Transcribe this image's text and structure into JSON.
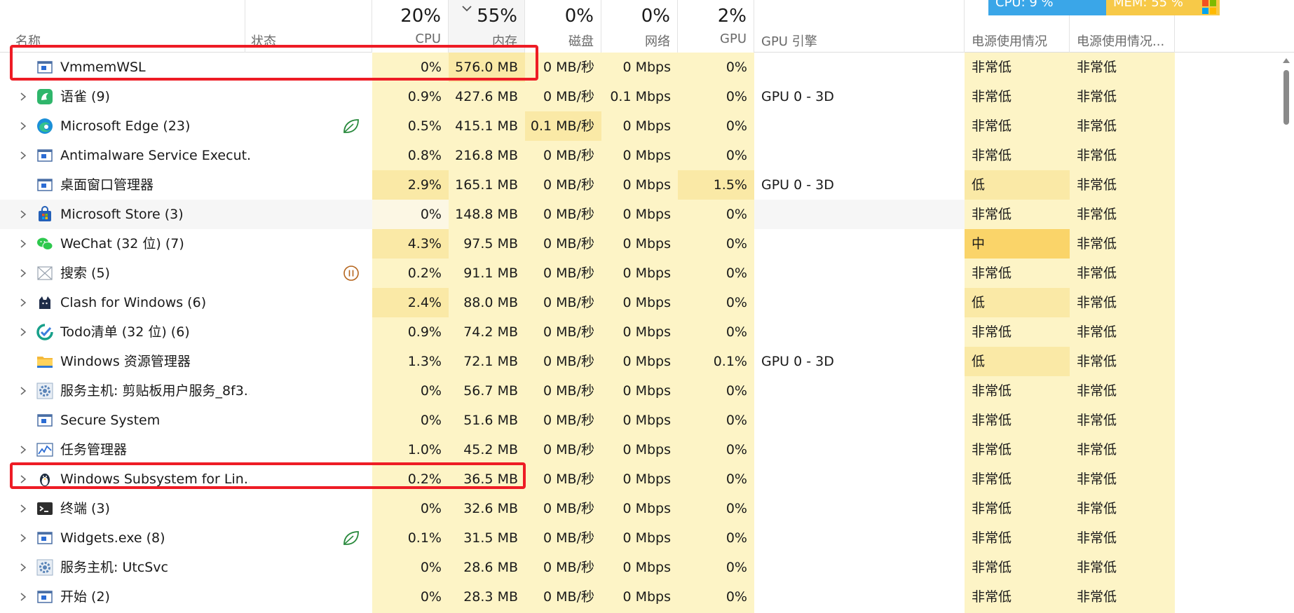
{
  "header": {
    "name_label": "名称",
    "status_label": "状态",
    "cpu_pct": "20%",
    "cpu_label": "CPU",
    "mem_pct": "55%",
    "mem_label": "内存",
    "disk_pct": "0%",
    "disk_label": "磁盘",
    "net_pct": "0%",
    "net_label": "网络",
    "gpu_pct": "2%",
    "gpu_label": "GPU",
    "gpu_engine_label": "GPU 引擎",
    "power_label": "电源使用情况",
    "power_trend_label": "电源使用情况..."
  },
  "overlay": {
    "cpu_text": "CPU: 9 %",
    "mem_text": "MEM: 55 %"
  },
  "colors": {
    "heat_low": "#fdf4c6",
    "heat_mid": "#fae9a6",
    "heat_high": "#fad469",
    "highlight_box": "#ee1c25",
    "cpu_overlay": "#3aa6e8",
    "mem_overlay": "#f7c948"
  },
  "rows": [
    {
      "name": "VmmemWSL",
      "icon": "app-window-icon",
      "expand": false,
      "status": "",
      "cpu": "0%",
      "mem": "576.0 MB",
      "disk": "0 MB/秒",
      "net": "0 Mbps",
      "gpu": "0%",
      "gpu_engine": "",
      "power": "非常低",
      "power_trend": "非常低"
    },
    {
      "name": "语雀 (9)",
      "icon": "yuque-bird-icon",
      "expand": true,
      "status": "",
      "cpu": "0.9%",
      "mem": "427.6 MB",
      "disk": "0 MB/秒",
      "net": "0.1 Mbps",
      "gpu": "0%",
      "gpu_engine": "GPU 0 - 3D",
      "power": "非常低",
      "power_trend": "非常低"
    },
    {
      "name": "Microsoft Edge (23)",
      "icon": "edge-icon",
      "expand": true,
      "status": "efficiency-leaf-icon",
      "cpu": "0.5%",
      "mem": "415.1 MB",
      "disk": "0.1 MB/秒",
      "net": "0 Mbps",
      "gpu": "0%",
      "gpu_engine": "",
      "power": "非常低",
      "power_trend": "非常低"
    },
    {
      "name": "Antimalware Service Execut...",
      "icon": "app-window-icon",
      "expand": true,
      "status": "",
      "cpu": "0.8%",
      "mem": "216.8 MB",
      "disk": "0 MB/秒",
      "net": "0 Mbps",
      "gpu": "0%",
      "gpu_engine": "",
      "power": "非常低",
      "power_trend": "非常低"
    },
    {
      "name": "桌面窗口管理器",
      "icon": "app-window-icon",
      "expand": false,
      "status": "",
      "cpu": "2.9%",
      "mem": "165.1 MB",
      "disk": "0 MB/秒",
      "net": "0 Mbps",
      "gpu": "1.5%",
      "gpu_engine": "GPU 0 - 3D",
      "power": "低",
      "power_trend": "非常低"
    },
    {
      "name": "Microsoft Store (3)",
      "icon": "store-bag-icon",
      "expand": true,
      "status": "",
      "cpu": "0%",
      "mem": "148.8 MB",
      "disk": "0 MB/秒",
      "net": "0 Mbps",
      "gpu": "0%",
      "gpu_engine": "",
      "power": "非常低",
      "power_trend": "非常低"
    },
    {
      "name": "WeChat (32 位) (7)",
      "icon": "wechat-icon",
      "expand": true,
      "status": "",
      "cpu": "4.3%",
      "mem": "97.5 MB",
      "disk": "0 MB/秒",
      "net": "0 Mbps",
      "gpu": "0%",
      "gpu_engine": "",
      "power": "中",
      "power_trend": "非常低"
    },
    {
      "name": "搜索 (5)",
      "icon": "search-window-icon",
      "expand": true,
      "status": "paused-icon",
      "cpu": "0.2%",
      "mem": "91.1 MB",
      "disk": "0 MB/秒",
      "net": "0 Mbps",
      "gpu": "0%",
      "gpu_engine": "",
      "power": "非常低",
      "power_trend": "非常低"
    },
    {
      "name": "Clash for Windows (6)",
      "icon": "clash-cat-icon",
      "expand": true,
      "status": "",
      "cpu": "2.4%",
      "mem": "88.0 MB",
      "disk": "0 MB/秒",
      "net": "0 Mbps",
      "gpu": "0%",
      "gpu_engine": "",
      "power": "低",
      "power_trend": "非常低"
    },
    {
      "name": "Todo清单 (32 位) (6)",
      "icon": "todo-check-icon",
      "expand": true,
      "status": "",
      "cpu": "0.9%",
      "mem": "74.2 MB",
      "disk": "0 MB/秒",
      "net": "0 Mbps",
      "gpu": "0%",
      "gpu_engine": "",
      "power": "非常低",
      "power_trend": "非常低"
    },
    {
      "name": "Windows 资源管理器",
      "icon": "folder-icon",
      "expand": false,
      "status": "",
      "cpu": "1.3%",
      "mem": "72.1 MB",
      "disk": "0 MB/秒",
      "net": "0 Mbps",
      "gpu": "0.1%",
      "gpu_engine": "GPU 0 - 3D",
      "power": "低",
      "power_trend": "非常低"
    },
    {
      "name": "服务主机: 剪贴板用户服务_8f3...",
      "icon": "gear-icon",
      "expand": true,
      "status": "",
      "cpu": "0%",
      "mem": "56.7 MB",
      "disk": "0 MB/秒",
      "net": "0 Mbps",
      "gpu": "0%",
      "gpu_engine": "",
      "power": "非常低",
      "power_trend": "非常低"
    },
    {
      "name": "Secure System",
      "icon": "app-window-icon",
      "expand": false,
      "status": "",
      "cpu": "0%",
      "mem": "51.6 MB",
      "disk": "0 MB/秒",
      "net": "0 Mbps",
      "gpu": "0%",
      "gpu_engine": "",
      "power": "非常低",
      "power_trend": "非常低"
    },
    {
      "name": "任务管理器",
      "icon": "task-manager-icon",
      "expand": true,
      "status": "",
      "cpu": "1.0%",
      "mem": "45.2 MB",
      "disk": "0 MB/秒",
      "net": "0 Mbps",
      "gpu": "0%",
      "gpu_engine": "",
      "power": "非常低",
      "power_trend": "非常低"
    },
    {
      "name": "Windows Subsystem for Lin...",
      "icon": "linux-penguin-icon",
      "expand": true,
      "status": "",
      "cpu": "0.2%",
      "mem": "36.5 MB",
      "disk": "0 MB/秒",
      "net": "0 Mbps",
      "gpu": "0%",
      "gpu_engine": "",
      "power": "非常低",
      "power_trend": "非常低"
    },
    {
      "name": "终端 (3)",
      "icon": "terminal-icon",
      "expand": true,
      "status": "",
      "cpu": "0%",
      "mem": "32.6 MB",
      "disk": "0 MB/秒",
      "net": "0 Mbps",
      "gpu": "0%",
      "gpu_engine": "",
      "power": "非常低",
      "power_trend": "非常低"
    },
    {
      "name": "Widgets.exe (8)",
      "icon": "app-window-icon",
      "expand": true,
      "status": "efficiency-leaf-icon",
      "cpu": "0.1%",
      "mem": "31.5 MB",
      "disk": "0 MB/秒",
      "net": "0 Mbps",
      "gpu": "0%",
      "gpu_engine": "",
      "power": "非常低",
      "power_trend": "非常低"
    },
    {
      "name": "服务主机: UtcSvc",
      "icon": "gear-icon",
      "expand": true,
      "status": "",
      "cpu": "0%",
      "mem": "28.6 MB",
      "disk": "0 MB/秒",
      "net": "0 Mbps",
      "gpu": "0%",
      "gpu_engine": "",
      "power": "非常低",
      "power_trend": "非常低"
    },
    {
      "name": "开始 (2)",
      "icon": "app-window-icon",
      "expand": true,
      "status": "",
      "cpu": "0%",
      "mem": "28.3 MB",
      "disk": "0 MB/秒",
      "net": "0 Mbps",
      "gpu": "0%",
      "gpu_engine": "",
      "power": "非常低",
      "power_trend": "非常低"
    }
  ]
}
